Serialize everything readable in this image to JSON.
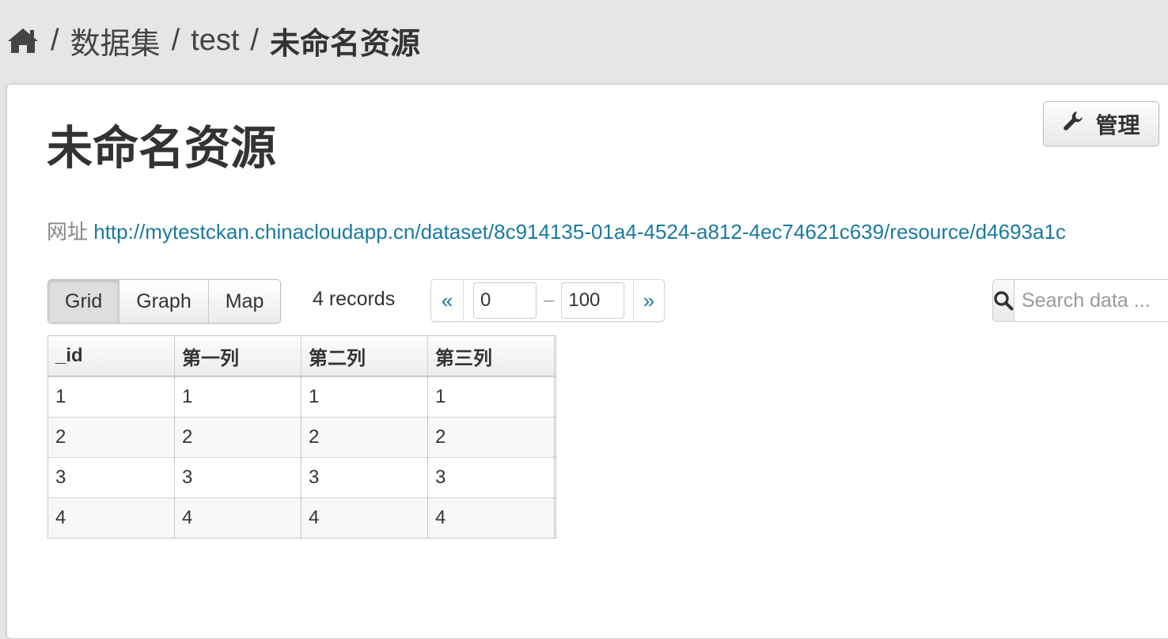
{
  "breadcrumb": {
    "home_icon": "home-icon",
    "separator": "/",
    "items": [
      "数据集",
      "test"
    ],
    "current": "未命名资源"
  },
  "page": {
    "title": "未命名资源",
    "manage_label": "管理",
    "manage_icon": "wrench-icon",
    "url_label": "网址",
    "url": "http://mytestckan.chinacloudapp.cn/dataset/8c914135-01a4-4524-a812-4ec74621c639/resource/d4693a1c"
  },
  "viewer": {
    "views": [
      "Grid",
      "Graph",
      "Map"
    ],
    "active_view": "Grid",
    "record_count": "4 records",
    "pager": {
      "prev": "«",
      "from": "0",
      "dash": "–",
      "to": "100",
      "next": "»"
    },
    "search": {
      "icon": "search-icon",
      "placeholder": "Search data ..."
    }
  },
  "grid": {
    "columns": [
      "_id",
      "第一列",
      "第二列",
      "第三列"
    ],
    "rows": [
      [
        "1",
        "1",
        "1",
        "1"
      ],
      [
        "2",
        "2",
        "2",
        "2"
      ],
      [
        "3",
        "3",
        "3",
        "3"
      ],
      [
        "4",
        "4",
        "4",
        "4"
      ]
    ]
  }
}
